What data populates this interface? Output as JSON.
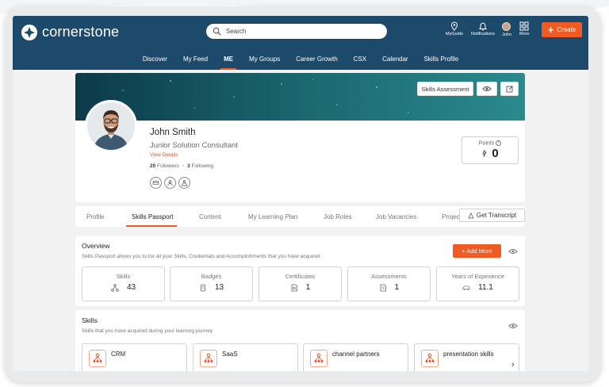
{
  "brand": {
    "name": "cornerstone",
    "accent": "#f15a22",
    "header_bg": "#1d4a6b"
  },
  "search": {
    "placeholder": "Search"
  },
  "utilities": [
    {
      "label": "MyGuide",
      "icon": "pin-icon"
    },
    {
      "label": "Notifications",
      "icon": "bell-icon"
    },
    {
      "label": "John",
      "icon": "avatar"
    },
    {
      "label": "More",
      "icon": "grid-icon"
    }
  ],
  "create_label": "Create",
  "nav": [
    "Discover",
    "My Feed",
    "ME",
    "My Groups",
    "Career Growth",
    "CSX",
    "Calendar",
    "Skills Profile"
  ],
  "nav_active": "ME",
  "profile": {
    "skills_assessment_label": "Skills Assessment",
    "name": "John Smith",
    "title": "Junior Solution Consultant",
    "view_details": "View Details",
    "followers_count": "20",
    "followers_label": "Followers",
    "following_count": "3",
    "following_label": "Following",
    "points_label": "Points",
    "points_value": "0"
  },
  "tabs": [
    "Profile",
    "Skills Passport",
    "Content",
    "My Learning Plan",
    "Job Roles",
    "Job Vacancies",
    "Projec"
  ],
  "tab_active": "Skills Passport",
  "transcript_label": "Get Transcript",
  "overview": {
    "title": "Overview",
    "description": "Skills Passport allows you to list all your Skills, Credentials and Accomplishments that you have acquired",
    "add_more_label": "+ Add More",
    "stats": [
      {
        "label": "Skills",
        "value": "43",
        "icon": "skills-icon"
      },
      {
        "label": "Badges",
        "value": "13",
        "icon": "badge-icon"
      },
      {
        "label": "Certificates",
        "value": "1",
        "icon": "certificate-icon"
      },
      {
        "label": "Assessments",
        "value": "1",
        "icon": "assessment-icon"
      },
      {
        "label": "Years of Experience",
        "value": "11.1",
        "icon": "car-icon"
      }
    ]
  },
  "skills": {
    "title": "Skills",
    "description": "Skills that you have acquired during your learning journey",
    "items": [
      "CRM",
      "SaaS",
      "channel partners",
      "presentation skills"
    ]
  }
}
